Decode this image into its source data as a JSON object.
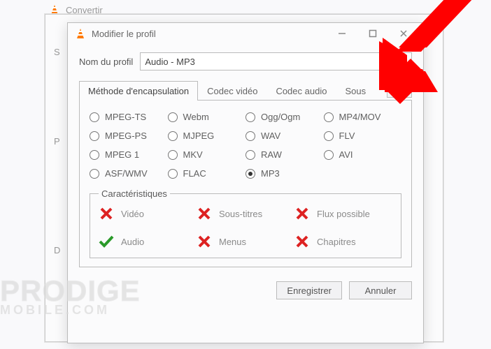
{
  "parent_window": {
    "title": "Convertir"
  },
  "dialog": {
    "title": "Modifier le profil",
    "profile_label": "Nom du profil",
    "profile_value": "Audio - MP3",
    "tabs": {
      "encapsulation": "Méthode d'encapsulation",
      "video": "Codec vidéo",
      "audio": "Codec audio",
      "subs": "Sous"
    },
    "radios": {
      "mpegts": "MPEG-TS",
      "webm": "Webm",
      "oggogm": "Ogg/Ogm",
      "mp4mov": "MP4/MOV",
      "mpegps": "MPEG-PS",
      "mjpeg": "MJPEG",
      "wav": "WAV",
      "flv": "FLV",
      "mpeg1": "MPEG 1",
      "mkv": "MKV",
      "raw": "RAW",
      "avi": "AVI",
      "asfwmv": "ASF/WMV",
      "flac": "FLAC",
      "mp3": "MP3"
    },
    "selected_radio": "mp3",
    "carac_legend": "Caractéristiques",
    "features": {
      "video": "Vidéo",
      "subtitles": "Sous-titres",
      "streamable": "Flux possible",
      "audio": "Audio",
      "menus": "Menus",
      "chapters": "Chapitres"
    },
    "buttons": {
      "save": "Enregistrer",
      "cancel": "Annuler"
    }
  },
  "colors": {
    "accent_red": "#d22",
    "accent_green": "#2a2",
    "arrow": "#ff0000"
  },
  "watermark": {
    "l1": "PRODIGE",
    "l2": "MOBILE.COM"
  }
}
